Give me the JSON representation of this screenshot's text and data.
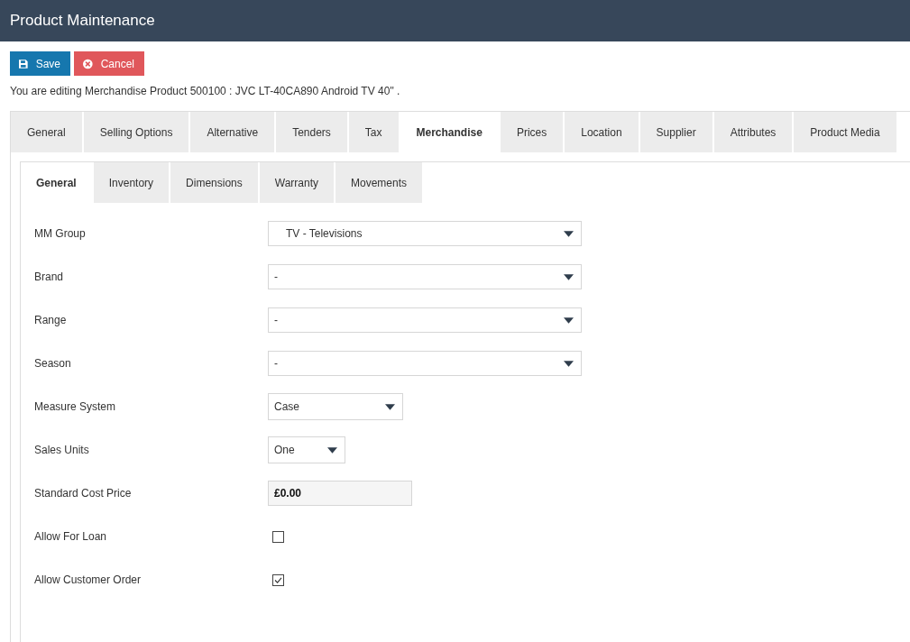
{
  "header": {
    "title": "Product Maintenance"
  },
  "toolbar": {
    "buttons": [
      {
        "label": "Save",
        "kind": "save"
      },
      {
        "label": "Cancel",
        "kind": "cancel"
      }
    ]
  },
  "editing_notice": "You are editing Merchandise Product 500100 : JVC LT-40CA890 Android TV 40\" .",
  "tabs": [
    {
      "label": "General",
      "selected": false
    },
    {
      "label": "Selling Options",
      "selected": false
    },
    {
      "label": "Alternative",
      "selected": false
    },
    {
      "label": "Tenders",
      "selected": false
    },
    {
      "label": "Tax",
      "selected": false
    },
    {
      "label": "Merchandise",
      "selected": true
    },
    {
      "label": "Prices",
      "selected": false
    },
    {
      "label": "Location",
      "selected": false
    },
    {
      "label": "Supplier",
      "selected": false
    },
    {
      "label": "Attributes",
      "selected": false
    },
    {
      "label": "Product Media",
      "selected": false
    }
  ],
  "sub_tabs": [
    {
      "label": "General",
      "selected": true
    },
    {
      "label": "Inventory",
      "selected": false
    },
    {
      "label": "Dimensions",
      "selected": false
    },
    {
      "label": "Warranty",
      "selected": false
    },
    {
      "label": "Movements",
      "selected": false
    }
  ],
  "form": {
    "fields": [
      {
        "label": "MM Group",
        "kind": "select",
        "value": "TV - Televisions"
      },
      {
        "label": "Brand",
        "kind": "select",
        "value": "-"
      },
      {
        "label": "Range",
        "kind": "select",
        "value": "-"
      },
      {
        "label": "Season",
        "kind": "select",
        "value": "-"
      },
      {
        "label": "Measure System",
        "kind": "select",
        "value": "Case"
      },
      {
        "label": "Sales Units",
        "kind": "select",
        "value": "One"
      },
      {
        "label": "Standard Cost Price",
        "kind": "input",
        "value": "£0.00",
        "readonly": true
      },
      {
        "label": "Allow For Loan",
        "kind": "checkbox",
        "checked": false
      },
      {
        "label": "Allow Customer Order",
        "kind": "checkbox",
        "checked": true
      }
    ]
  }
}
